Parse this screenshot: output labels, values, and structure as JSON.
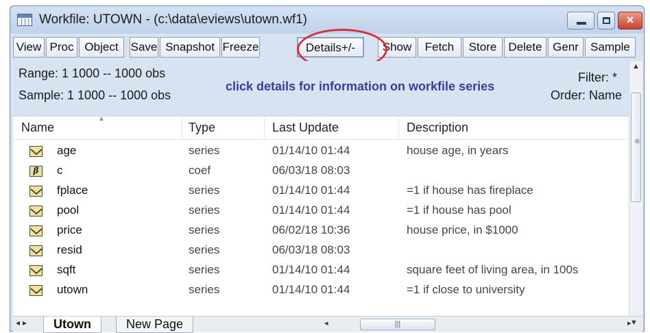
{
  "window": {
    "title": "Workfile: UTOWN - (c:\\data\\eviews\\utown.wf1)",
    "close_glyph": "×"
  },
  "toolbar": {
    "buttons": [
      "View",
      "Proc",
      "Object",
      "Save",
      "Snapshot",
      "Freeze",
      "Details+/-",
      "Show",
      "Fetch",
      "Store",
      "Delete",
      "Genr",
      "Sample"
    ]
  },
  "info": {
    "range_line": "Range:  1 1000   --   1000 obs",
    "sample_line": "Sample: 1 1000   --   1000 obs",
    "filter_line": "Filter: *",
    "order_line": "Order: Name",
    "callout": "click details for information on workfile series"
  },
  "list": {
    "columns": [
      "Name",
      "Type",
      "Last Update",
      "Description"
    ],
    "rows": [
      {
        "name": "age",
        "type": "series",
        "updated": "01/14/10  01:44",
        "description": "house age, in years"
      },
      {
        "name": "c",
        "type": "coef",
        "updated": "06/03/18  08:03",
        "description": ""
      },
      {
        "name": "fplace",
        "type": "series",
        "updated": "01/14/10  01:44",
        "description": "=1 if house has fireplace"
      },
      {
        "name": "pool",
        "type": "series",
        "updated": "01/14/10  01:44",
        "description": "=1 if house has pool"
      },
      {
        "name": "price",
        "type": "series",
        "updated": "06/02/18  10:36",
        "description": "house price, in $1000"
      },
      {
        "name": "resid",
        "type": "series",
        "updated": "06/03/18  08:03",
        "description": ""
      },
      {
        "name": "sqft",
        "type": "series",
        "updated": "01/14/10  01:44",
        "description": "square feet of living area, in 100s"
      },
      {
        "name": "utown",
        "type": "series",
        "updated": "01/14/10  01:44",
        "description": "=1 if close to university"
      }
    ]
  },
  "tabs": {
    "active": "Utown",
    "new_page": "New Page"
  },
  "icons": {
    "series": "series-icon",
    "coef": "coef-icon",
    "coef_glyph": "β"
  },
  "colors": {
    "annotation": "#d72e37",
    "callout_text": "#3b3b9d",
    "panel_bg": "#d7e3f1"
  }
}
